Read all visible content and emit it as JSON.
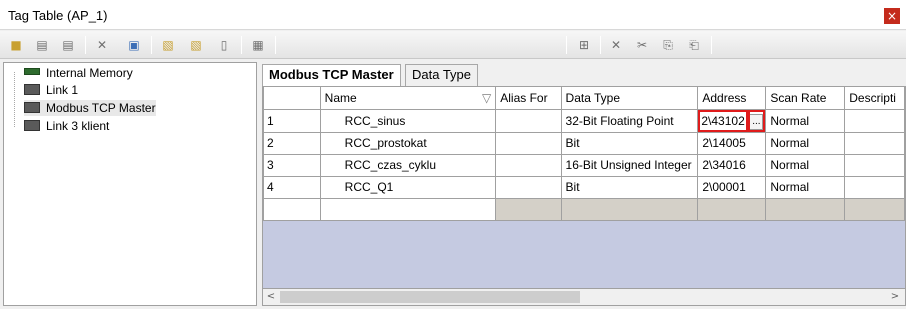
{
  "window": {
    "title": "Tag Table (AP_1)",
    "close_glyph": "×"
  },
  "toolbar": {
    "left_icons": [
      "add-link-icon",
      "open-link-icon",
      "save-link-icon",
      "delete-link-icon",
      "rename-link-icon",
      "copy-icon",
      "paste-icon",
      "paste-link-icon",
      "device-icon"
    ],
    "right_icons": [
      "add-tag-icon",
      "delete-tag-icon",
      "cut-icon",
      "copy-tag-icon",
      "paste-tag-icon"
    ]
  },
  "tree": {
    "items": [
      {
        "label": "Internal Memory",
        "icon": "memory-icon"
      },
      {
        "label": "Link 1",
        "icon": "device-icon"
      },
      {
        "label": "Modbus TCP Master",
        "icon": "device-icon",
        "selected": true
      },
      {
        "label": "Link 3 klient",
        "icon": "device-icon"
      }
    ]
  },
  "tabs": [
    {
      "label": "Modbus TCP Master",
      "active": true
    },
    {
      "label": "Data Type",
      "active": false
    }
  ],
  "grid": {
    "columns": [
      "",
      "Name",
      "Alias For",
      "Data Type",
      "Address",
      "Scan Rate",
      "Descripti"
    ],
    "rows": [
      {
        "num": "1",
        "name": "RCC_sinus",
        "alias": "",
        "type": "32-Bit Floating Point",
        "address": "2\\43102",
        "scan": "Normal",
        "desc": ""
      },
      {
        "num": "2",
        "name": "RCC_prostokat",
        "alias": "",
        "type": "Bit",
        "address": "2\\14005",
        "scan": "Normal",
        "desc": ""
      },
      {
        "num": "3",
        "name": "RCC_czas_cyklu",
        "alias": "",
        "type": "16-Bit Unsigned Integer",
        "address": "2\\34016",
        "scan": "Normal",
        "desc": ""
      },
      {
        "num": "4",
        "name": "RCC_Q1",
        "alias": "",
        "type": "Bit",
        "address": "2\\00001",
        "scan": "Normal",
        "desc": ""
      }
    ],
    "browse_button": "...",
    "filter_glyph": "▽"
  },
  "scrollbar": {
    "left_arrow": "<",
    "right_arrow": ">"
  }
}
